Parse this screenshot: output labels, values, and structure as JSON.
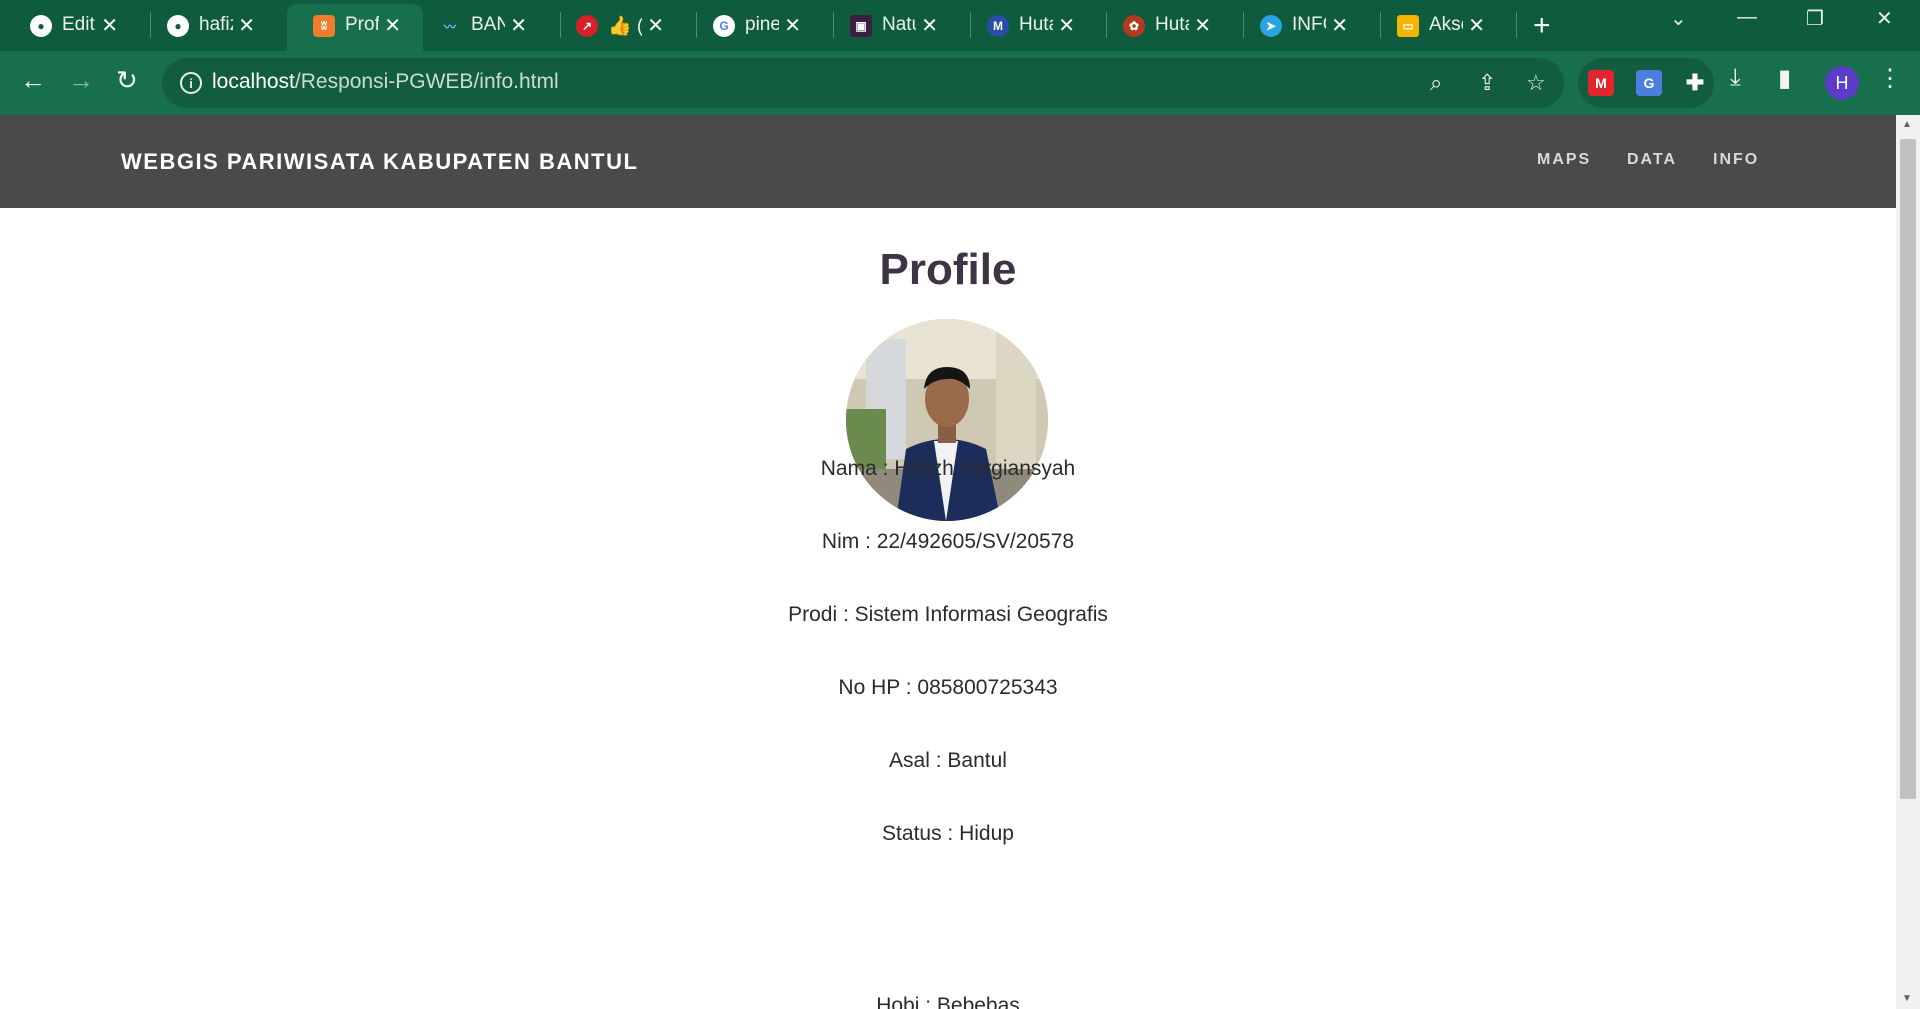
{
  "browser": {
    "tabs": [
      {
        "label": "Editi",
        "icon": "github-icon"
      },
      {
        "label": "hafiz",
        "icon": "github-icon"
      },
      {
        "label": "Profi",
        "icon": "xampp-icon",
        "active": true
      },
      {
        "label": "BAN",
        "icon": "site-icon"
      },
      {
        "label": "👍 (",
        "icon": "site-icon"
      },
      {
        "label": "pine",
        "icon": "google-icon"
      },
      {
        "label": "Natu",
        "icon": "site-icon"
      },
      {
        "label": "Huta",
        "icon": "site-icon"
      },
      {
        "label": "Huta",
        "icon": "site-icon"
      },
      {
        "label": "INFC",
        "icon": "telegram-icon"
      },
      {
        "label": "Akse",
        "icon": "slides-icon"
      }
    ],
    "url_host": "localhost",
    "url_path": "/Responsi-PGWEB/info.html",
    "profile_initial": "H",
    "accent": "#186f4d"
  },
  "site": {
    "brand": "WEBGIS PARIWISATA KABUPATEN BANTUL",
    "nav": [
      "MAPS",
      "DATA",
      "INFO"
    ]
  },
  "profile": {
    "title": "Profile",
    "lines": [
      "Nama : Hafizh Vergiansyah",
      "Nim : 22/492605/SV/20578",
      "Prodi : Sistem Informasi Geografis",
      "No HP : 085800725343",
      "Asal : Bantul",
      "Status : Hidup",
      "Hobi : Bebebas"
    ]
  }
}
